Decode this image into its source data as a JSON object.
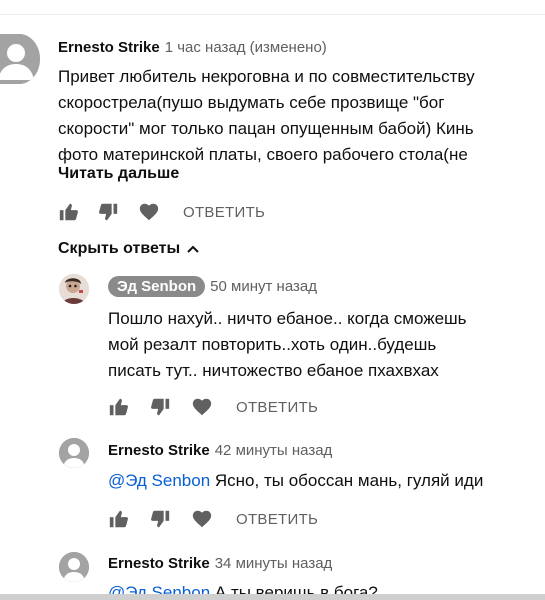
{
  "comment": {
    "author": "Ernesto Strike",
    "time": "1 час назад (изменено)",
    "lines": [
      "Привет любитель некроговна и по совместительству",
      "скорострела(пушо выдумать себе прозвище \"бог",
      "скорости\" мог только пацан опущенным бабой) Кинь",
      "фото материнской платы, своего рабочего стола(не"
    ],
    "read_more": "Читать дальше",
    "reply_label": "ОТВЕТИТЬ"
  },
  "hide_replies_label": "Скрыть ответы",
  "replies": [
    {
      "author": "Эд Senbon",
      "time": "50 минут назад",
      "lines": [
        "Пошло нахуй.. ничто ебаное.. когда сможешь",
        "мой резалт повторить..хоть один..будешь",
        "писать тут.. ничтожество ебаное пхахвхах"
      ],
      "reply_label": "ОТВЕТИТЬ"
    },
    {
      "author": "Ernesto Strike",
      "time": "42 минуты назад",
      "mention": "@Эд Senbon",
      "text": " Ясно, ты обоссан мань, гуляй иди",
      "reply_label": "ОТВЕТИТЬ"
    },
    {
      "author": "Ernesto Strike",
      "time": "34 минуты назад",
      "mention": "@Эд Senbon",
      "text": " А ты веришь в бога?"
    }
  ],
  "icons": {
    "like": "thumb-up-icon",
    "dislike": "thumb-down-icon",
    "heart": "heart-icon",
    "avatar": "default-avatar-icon",
    "chevron": "chevron-up-icon"
  },
  "colors": {
    "mention": "#065fd4",
    "secondary_text": "#606060",
    "icon": "#606060",
    "author_chip": "#8a8a8a"
  }
}
